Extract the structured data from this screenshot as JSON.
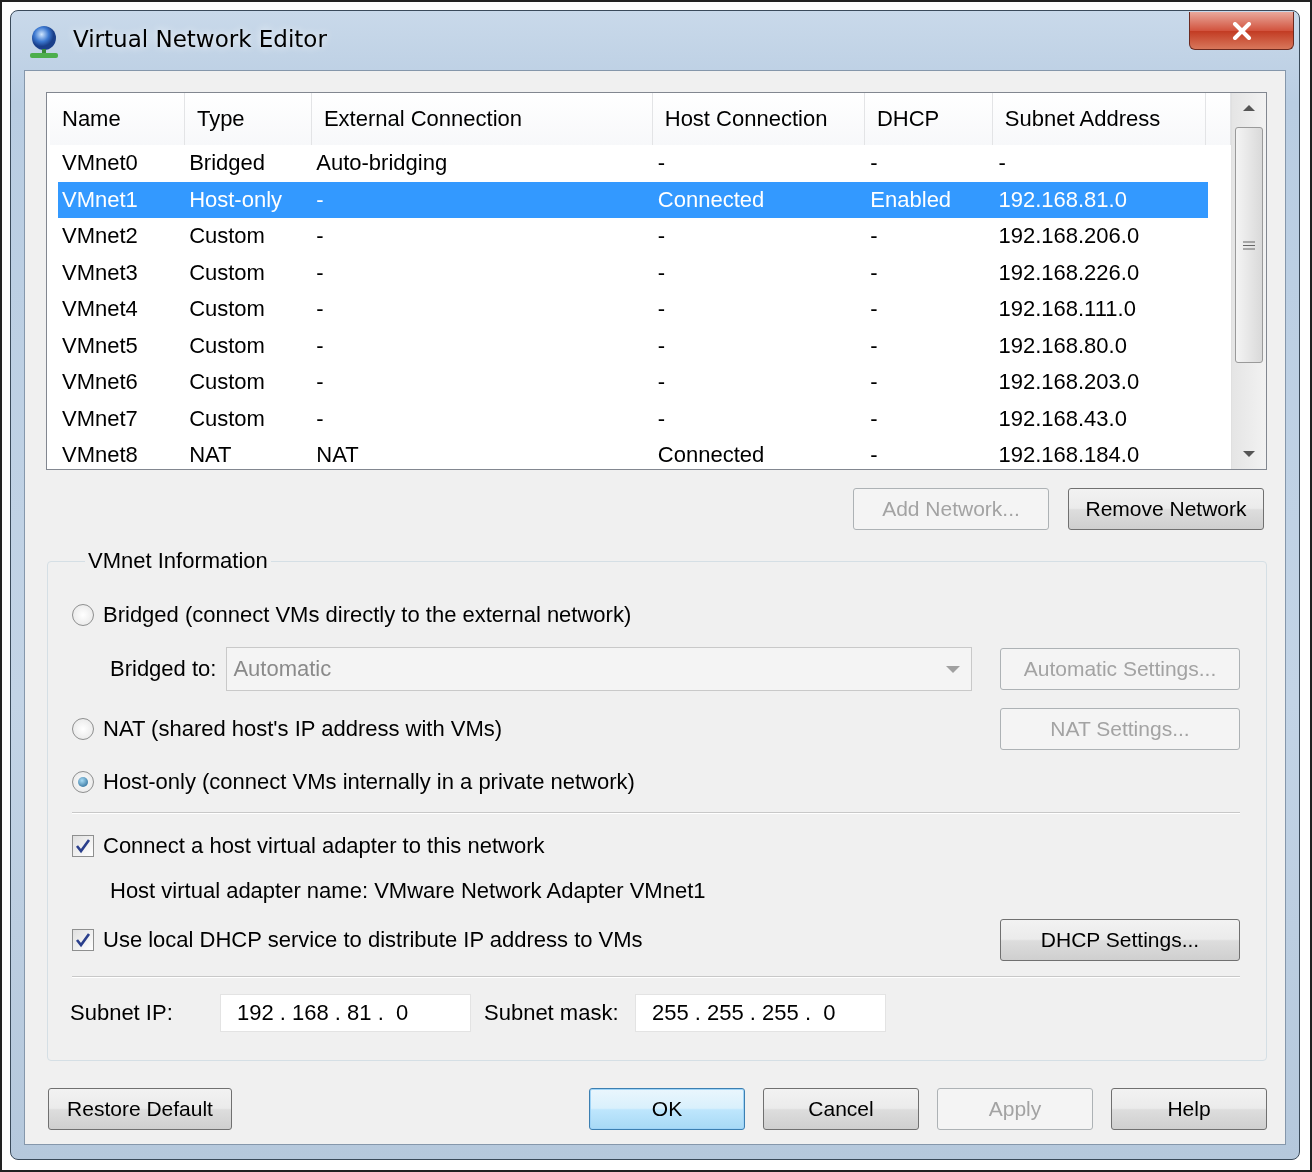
{
  "window": {
    "title": "Virtual Network Editor"
  },
  "network_table": {
    "columns": [
      "Name",
      "Type",
      "External Connection",
      "Host Connection",
      "DHCP",
      "Subnet Address"
    ],
    "rows": [
      {
        "cells": [
          "VMnet0",
          "Bridged",
          "Auto-bridging",
          "-",
          "-",
          "-"
        ],
        "selected": false
      },
      {
        "cells": [
          "VMnet1",
          "Host-only",
          "-",
          "Connected",
          "Enabled",
          "192.168.81.0"
        ],
        "selected": true
      },
      {
        "cells": [
          "VMnet2",
          "Custom",
          "-",
          "-",
          "-",
          "192.168.206.0"
        ],
        "selected": false
      },
      {
        "cells": [
          "VMnet3",
          "Custom",
          "-",
          "-",
          "-",
          "192.168.226.0"
        ],
        "selected": false
      },
      {
        "cells": [
          "VMnet4",
          "Custom",
          "-",
          "-",
          "-",
          "192.168.111.0"
        ],
        "selected": false
      },
      {
        "cells": [
          "VMnet5",
          "Custom",
          "-",
          "-",
          "-",
          "192.168.80.0"
        ],
        "selected": false
      },
      {
        "cells": [
          "VMnet6",
          "Custom",
          "-",
          "-",
          "-",
          "192.168.203.0"
        ],
        "selected": false
      },
      {
        "cells": [
          "VMnet7",
          "Custom",
          "-",
          "-",
          "-",
          "192.168.43.0"
        ],
        "selected": false
      },
      {
        "cells": [
          "VMnet8",
          "NAT",
          "NAT",
          "Connected",
          "-",
          "192.168.184.0"
        ],
        "selected": false
      }
    ]
  },
  "table_buttons": [
    {
      "label": "Add Network...",
      "disabled": true
    },
    {
      "label": "Remove Network",
      "disabled": false
    }
  ],
  "vmnet_information": {
    "title": "VMnet Information",
    "connection_types": [
      {
        "label": "Bridged (connect VMs directly to the external network)",
        "selected": false
      },
      {
        "label": "NAT (shared host's IP address with VMs)",
        "selected": false
      },
      {
        "label": "Host-only (connect VMs internally in a private network)",
        "selected": true
      }
    ],
    "bridged_to": {
      "label": "Bridged to:",
      "value": "Automatic",
      "disabled": true
    },
    "automatic_settings_button": {
      "label": "Automatic Settings...",
      "disabled": true
    },
    "nat_settings_button": {
      "label": "NAT Settings...",
      "disabled": true
    },
    "host_adapter_checkbox": {
      "label": "Connect a host virtual adapter to this network",
      "checked": true
    },
    "adapter_name": "Host virtual adapter name: VMware Network Adapter VMnet1",
    "dhcp_checkbox": {
      "label": "Use local DHCP service to distribute IP address to VMs",
      "checked": true
    },
    "dhcp_settings_button": {
      "label": "DHCP Settings...",
      "disabled": false
    },
    "subnet_ip": {
      "label": "Subnet IP:",
      "value": "192 . 168 . 81 .  0"
    },
    "subnet_mask": {
      "label": "Subnet mask:",
      "value": "255 . 255 . 255 .  0"
    }
  },
  "footer_buttons": [
    {
      "label": "Restore Default",
      "disabled": false,
      "default": false
    },
    {
      "label": "OK",
      "disabled": false,
      "default": true
    },
    {
      "label": "Cancel",
      "disabled": false,
      "default": false
    },
    {
      "label": "Apply",
      "disabled": true,
      "default": false
    },
    {
      "label": "Help",
      "disabled": false,
      "default": false
    }
  ]
}
